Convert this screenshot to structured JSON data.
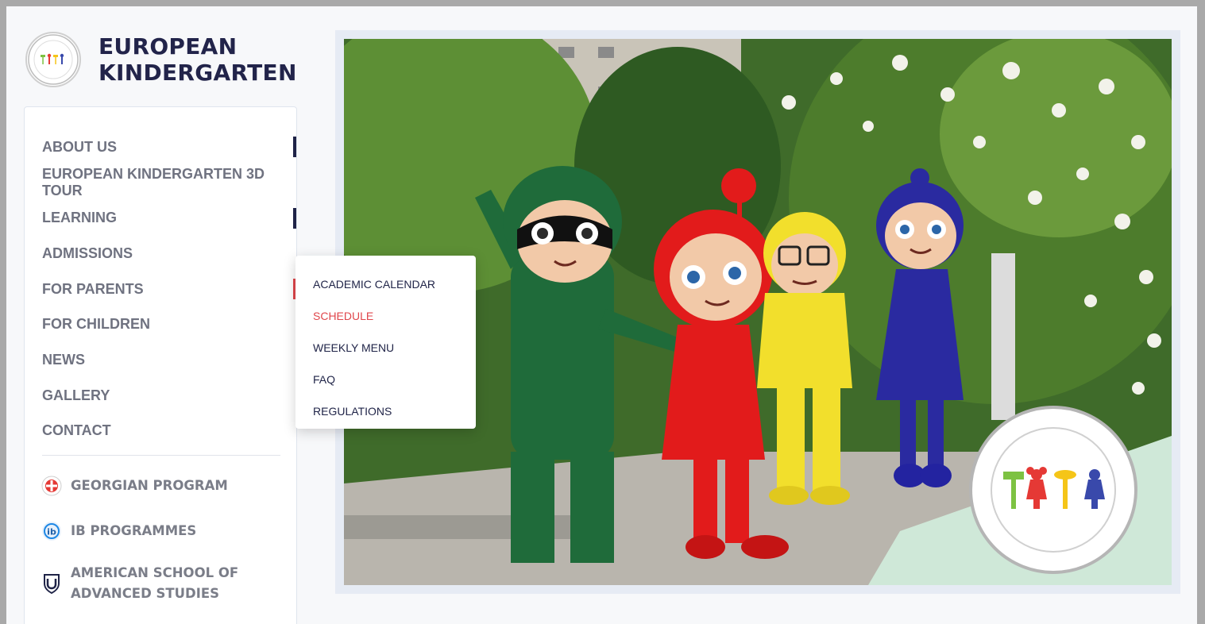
{
  "brand": {
    "line1": "EUROPEAN",
    "line2": "KINDERGARTEN"
  },
  "nav": {
    "items": [
      {
        "label": "ABOUT US",
        "marker": "#1f2347"
      },
      {
        "label": "EUROPEAN KINDERGARTEN 3D TOUR"
      },
      {
        "label": "LEARNING",
        "marker": "#1f2347"
      },
      {
        "label": "ADMISSIONS"
      },
      {
        "label": "FOR PARENTS",
        "marker": "#e0474c"
      },
      {
        "label": "FOR CHILDREN"
      },
      {
        "label": "NEWS"
      },
      {
        "label": "GALLERY"
      },
      {
        "label": "CONTACT"
      }
    ]
  },
  "programs": [
    {
      "label": "GEORGIAN PROGRAM",
      "icon": "georgian-program-icon"
    },
    {
      "label": "IB PROGRAMMES",
      "icon": "ib-icon"
    },
    {
      "label_line1": "AMERICAN SCHOOL OF",
      "label_line2": "ADVANCED STUDIES",
      "icon": "shield-icon"
    }
  ],
  "dropdown": {
    "items": [
      {
        "label": "ACADEMIC CALENDAR"
      },
      {
        "label": "SCHEDULE",
        "active": true
      },
      {
        "label": "WEEKLY MENU"
      },
      {
        "label": "FAQ"
      },
      {
        "label": "REGULATIONS"
      }
    ]
  },
  "colors": {
    "navy": "#1f2347",
    "accent_red": "#e0474c",
    "nav_text": "#6f7280"
  }
}
